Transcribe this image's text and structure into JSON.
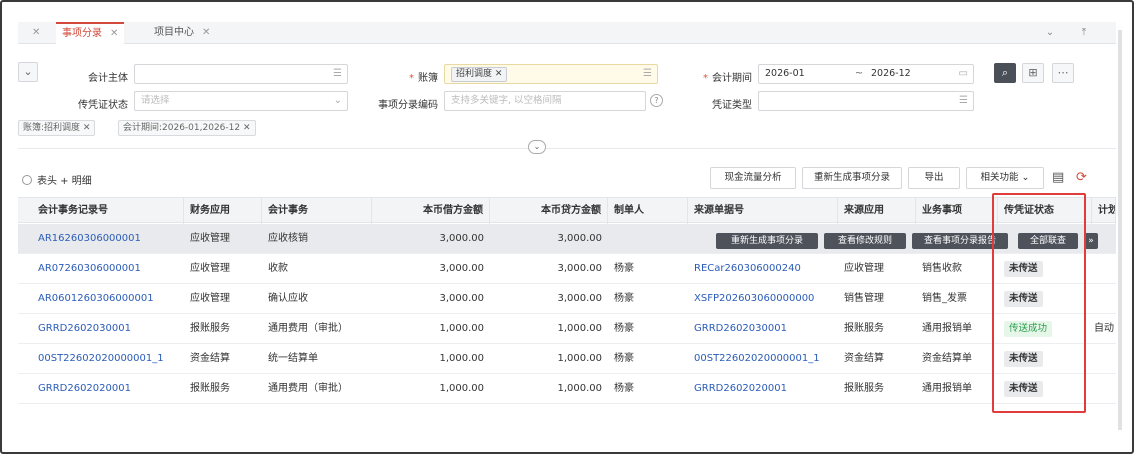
{
  "tabs": [
    {
      "label": "",
      "active": false
    },
    {
      "label": "事项分录",
      "active": true
    },
    {
      "label": "项目中心",
      "active": false
    }
  ],
  "filter": {
    "entity_label": "会计主体",
    "ledger_label": "账簿",
    "ledger_value": "招利调度",
    "period_label": "会计期间",
    "period_from": "2026-01",
    "period_to": "2026-12",
    "voucher_status_label": "传凭证状态",
    "voucher_status_placeholder": "请选择",
    "entry_code_label": "事项分录编码",
    "entry_code_placeholder": "支持多关键字, 以空格间隔",
    "voucher_type_label": "凭证类型",
    "tags": [
      "账簿:招利调度",
      "会计期间:2026-01,2026-12"
    ]
  },
  "toolbar": {
    "radio_label": "表头 + 明细",
    "buttons": [
      "现金流量分析",
      "重新生成事项分录",
      "导出",
      "相关功能"
    ]
  },
  "table": {
    "headers": [
      "会计事务记录号",
      "财务应用",
      "会计事务",
      "本币借方金额",
      "本币贷方金额",
      "制单人",
      "来源单据号",
      "来源应用",
      "业务事项",
      "传凭证状态",
      "计划"
    ],
    "rows": [
      {
        "id": "AR16260306000001",
        "app": "应收管理",
        "event": "应收核销",
        "debit": "3,000.00",
        "credit": "3,000.00",
        "maker": "",
        "source": "",
        "source_app": "",
        "biz": "",
        "status": "",
        "extra": ""
      },
      {
        "id": "AR07260306000001",
        "app": "应收管理",
        "event": "收款",
        "debit": "3,000.00",
        "credit": "3,000.00",
        "maker": "杨豪",
        "source": "RECar260306000240",
        "source_app": "应收管理",
        "biz": "销售收款",
        "status": "未传送",
        "extra": ""
      },
      {
        "id": "AR0601260306000001",
        "app": "应收管理",
        "event": "确认应收",
        "debit": "3,000.00",
        "credit": "3,000.00",
        "maker": "杨豪",
        "source": "XSFP202603060000000",
        "source_app": "销售管理",
        "biz": "销售_发票",
        "status": "未传送",
        "extra": ""
      },
      {
        "id": "GRRD2602030001",
        "app": "报账服务",
        "event": "通用费用（审批）",
        "debit": "1,000.00",
        "credit": "1,000.00",
        "maker": "杨豪",
        "source": "GRRD2602030001",
        "source_app": "报账服务",
        "biz": "通用报销单",
        "status": "传送成功",
        "extra": "自动"
      },
      {
        "id": "00ST22602020000001_1",
        "app": "资金结算",
        "event": "统一结算单",
        "debit": "1,000.00",
        "credit": "1,000.00",
        "maker": "杨豪",
        "source": "00ST22602020000001_1",
        "source_app": "资金结算",
        "biz": "资金结算单",
        "status": "未传送",
        "extra": ""
      },
      {
        "id": "GRRD2602020001",
        "app": "报账服务",
        "event": "通用费用（审批）",
        "debit": "1,000.00",
        "credit": "1,000.00",
        "maker": "杨豪",
        "source": "GRRD2602020001",
        "source_app": "报账服务",
        "biz": "通用报销单",
        "status": "未传送",
        "extra": ""
      }
    ]
  },
  "row_actions": [
    "重新生成事项分录",
    "查看修改规则",
    "查看事项分录报告",
    "全部联查"
  ],
  "colors": {
    "accent": "#d34a3b",
    "link": "#2b5cb8",
    "highlight_box": "#e03c3c",
    "success": "#2a9d4a"
  }
}
